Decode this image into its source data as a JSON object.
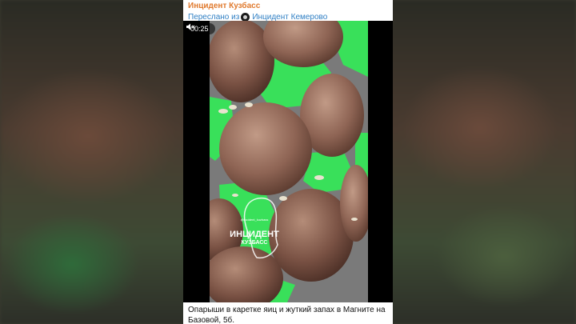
{
  "post": {
    "channel_name": "Инцидент Кузбасс",
    "forwarded_prefix": "Переслано из",
    "forwarded_from": "Инцидент Кемерово",
    "caption": "Опарыши в каретке яиц и жуткий запах в Магните на Базовой, 5б."
  },
  "video": {
    "duration": "00:25",
    "mute_icon": "speaker-muted-icon",
    "watermark_handle": "@incident_kuzbass",
    "watermark_title": "ИНЦИДЕНТ",
    "watermark_sub": "КУЗБАСС"
  },
  "colors": {
    "channel_name": "#e07a2e",
    "link": "#2f7fc4",
    "tray_green": "#39e05a"
  }
}
